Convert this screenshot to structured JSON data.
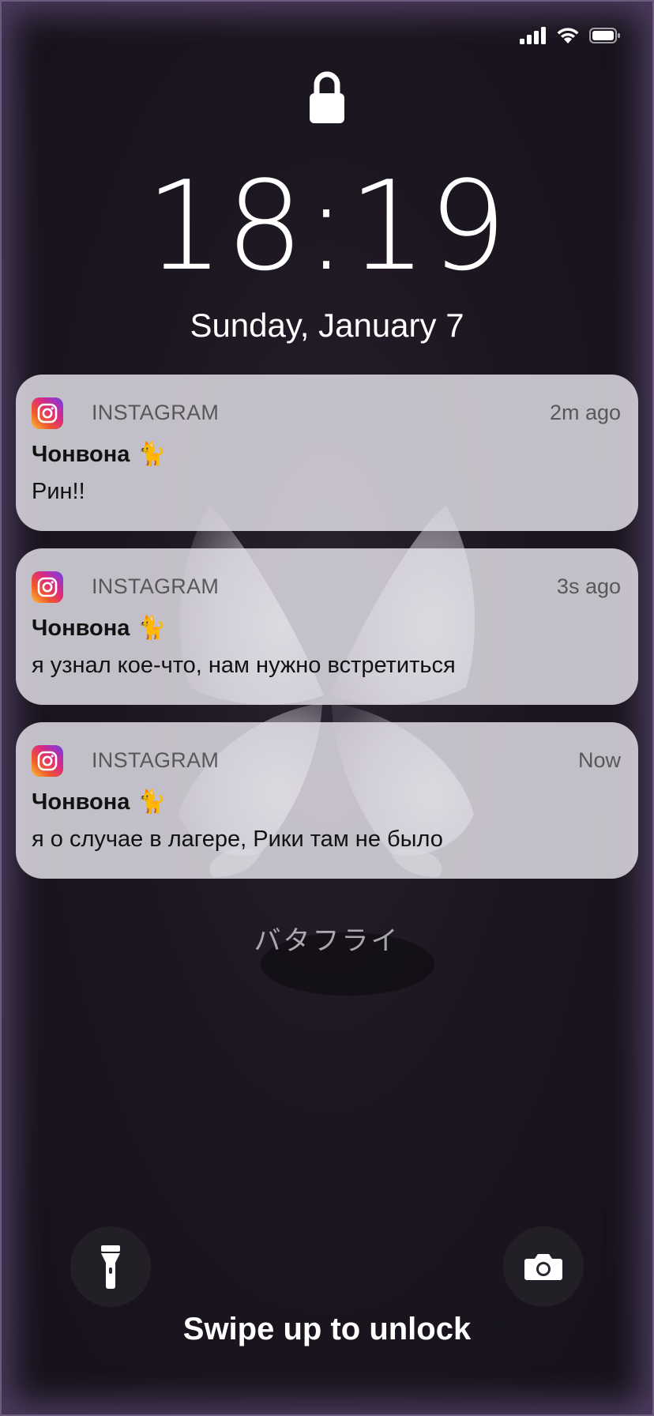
{
  "lockscreen": {
    "time": "18:19",
    "date": "Sunday, January 7",
    "wallpaper_caption": "バタフライ",
    "swipe_hint": "Swipe up to unlock"
  },
  "status_bar": {
    "icons": [
      "cellular-signal-icon",
      "wifi-icon",
      "battery-icon"
    ]
  },
  "notifications": [
    {
      "app": "INSTAGRAM",
      "time_ago": "2m ago",
      "sender": "Чонвона",
      "sender_emoji": "🐈",
      "message": "Рин!!"
    },
    {
      "app": "INSTAGRAM",
      "time_ago": "3s ago",
      "sender": "Чонвона",
      "sender_emoji": "🐈",
      "message": "я узнал кое-что, нам нужно встретиться"
    },
    {
      "app": "INSTAGRAM",
      "time_ago": "Now",
      "sender": "Чонвона",
      "sender_emoji": "🐈",
      "message": "я о случае в лагере, Рики там не было"
    }
  ],
  "quick_actions": [
    "flashlight-icon",
    "camera-icon"
  ],
  "colors": {
    "frame_accent": "#6d5a7e",
    "notification_bg": "#e4e0e8",
    "instagram_gradient": [
      "#f9c23c",
      "#f0592b",
      "#dd2a7b",
      "#9b35c7",
      "#5b51d8"
    ]
  }
}
